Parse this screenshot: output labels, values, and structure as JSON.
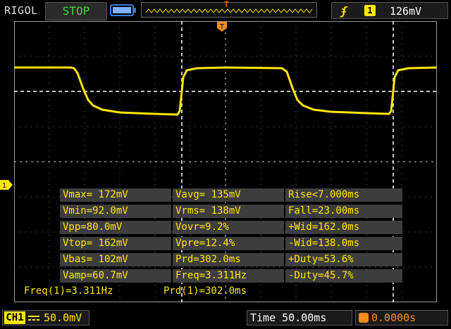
{
  "header": {
    "brand": "RIGOL",
    "run_state": "STOP",
    "trigger": {
      "edge_icon": "rising-edge-icon",
      "channel": "1",
      "level": "126mV"
    },
    "memory_marker": "T"
  },
  "markers": {
    "trigger_position": "T",
    "channel1": "1"
  },
  "measurements": [
    [
      "Vmax= 172mV",
      "Vavg= 135mV",
      "Rise<7.000ms"
    ],
    [
      "Vmin=92.0mV",
      "Vrms= 138mV",
      "Fall=23.00ms"
    ],
    [
      "Vpp=80.0mV",
      "Vovr=9.2%",
      "+Wid=162.0ms"
    ],
    [
      "Vtop= 162mV",
      "Vpre=12.4%",
      "-Wid=138.0ms"
    ],
    [
      "Vbas= 102mV",
      "Prd=302.0ms",
      "+Duty=53.6%"
    ],
    [
      "Vamp=60.7mV",
      "Freq=3.311Hz",
      "-Duty=45.7%"
    ]
  ],
  "readouts": {
    "freq": "Freq(1)=3.311Hz",
    "period": "Prd(1)=302.0ms"
  },
  "footer": {
    "channel_label": "CH1",
    "coupling_icon": "dc-coupling-icon",
    "volts_per_div": "50.0mV",
    "timebase": "Time 50.00ms",
    "trigger_offset": "0.0000s"
  },
  "colors": {
    "trace": "#ffe600",
    "trigger": "#ff8c1a",
    "run_state": "#3ddb3d",
    "grid": "#9a9a9a"
  }
}
